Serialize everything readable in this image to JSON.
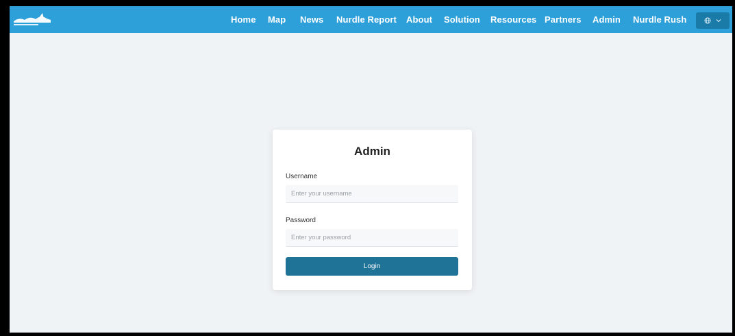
{
  "nav": {
    "logo_alt": "Nurdle Patrol logo",
    "links": [
      "Home",
      "Map",
      "News",
      "Nurdle Report",
      "About",
      "Solution",
      "Resources",
      "Partners",
      "Admin",
      "Nurdle Rush"
    ],
    "language_icon": "globe-icon",
    "dropdown_icon": "chevron-down-icon"
  },
  "login": {
    "title": "Admin",
    "username_label": "Username",
    "username_placeholder": "Enter your username",
    "password_label": "Password",
    "password_placeholder": "Enter your password",
    "login_label": "Login"
  },
  "colors": {
    "navbar": "#2d9fd9",
    "language_button": "#1a7aa8",
    "login_button": "#1e7397",
    "background": "#f0f3f6"
  }
}
